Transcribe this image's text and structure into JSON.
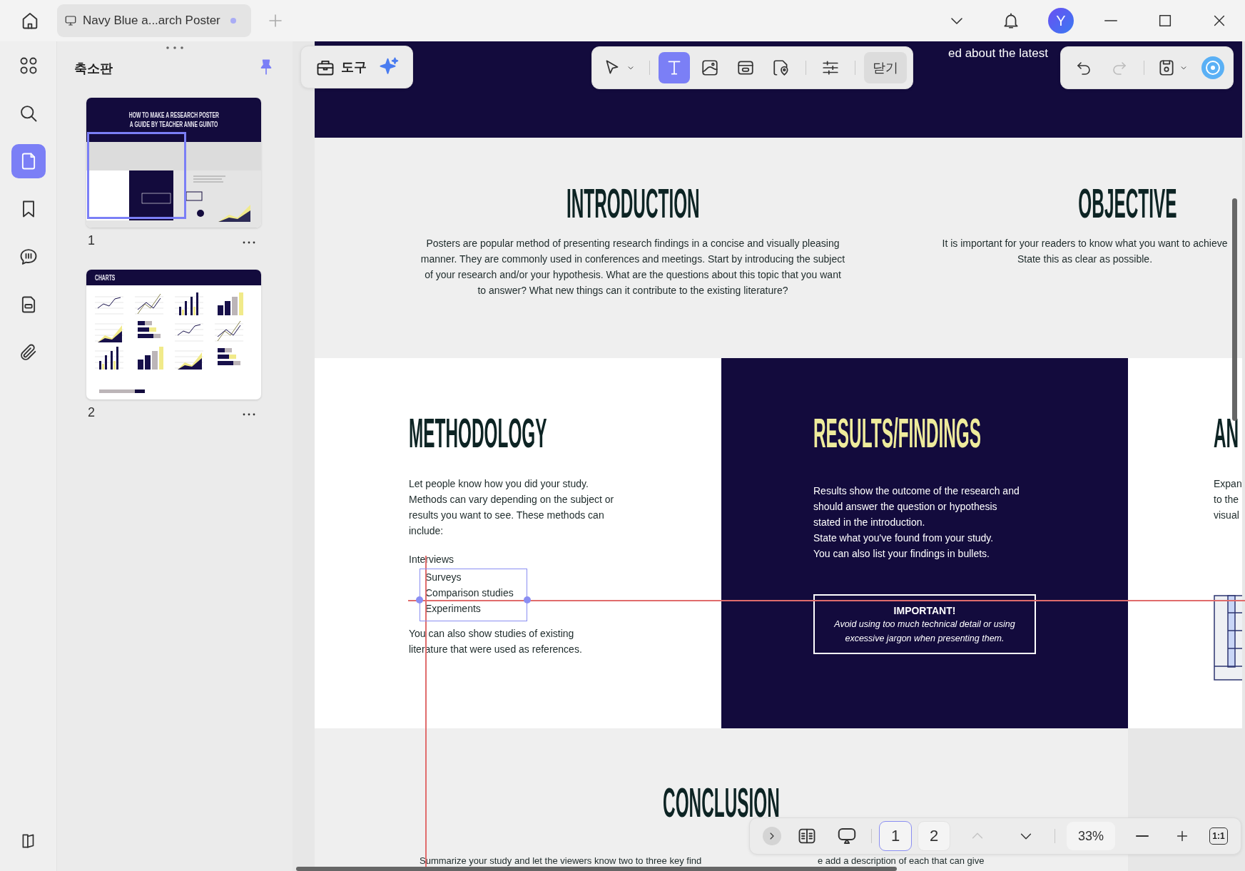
{
  "titlebar": {
    "tab": {
      "title": "Navy Blue a...arch Poster",
      "modified": true
    },
    "avatar": "Y"
  },
  "rail": [
    {
      "kind": "apps",
      "selected": false
    },
    {
      "kind": "search",
      "selected": false
    },
    {
      "kind": "pages",
      "selected": true
    },
    {
      "kind": "bookmark",
      "selected": false
    },
    {
      "kind": "comment",
      "selected": false
    },
    {
      "kind": "form",
      "selected": false
    },
    {
      "kind": "attachment",
      "selected": false
    }
  ],
  "panel": {
    "title": "축소판",
    "pinned": true
  },
  "thumbnails": [
    {
      "number": "1",
      "kind": "poster",
      "title_lines": [
        "HOW TO MAKE A RESEARCH POSTER",
        "A GUIDE BY TEACHER ANNE GUINTO"
      ]
    },
    {
      "number": "2",
      "kind": "charts",
      "title_lines": [
        "CHARTS"
      ]
    }
  ],
  "tools_bar": {
    "label": "도구"
  },
  "edit_toolbar": {
    "tools": [
      {
        "kind": "select",
        "selected": false
      },
      {
        "kind": "text",
        "selected": true
      },
      {
        "kind": "image",
        "selected": false
      },
      {
        "kind": "link",
        "selected": false
      },
      {
        "kind": "stamp",
        "selected": false
      },
      {
        "kind": "properties",
        "selected": false
      }
    ],
    "close_label": "닫기"
  },
  "history": [
    {
      "kind": "undo",
      "disabled": false
    },
    {
      "kind": "redo",
      "disabled": true
    }
  ],
  "page": {
    "banner_text": "ed about the latest",
    "introduction": {
      "heading": "INTRODUCTION",
      "lines": [
        "Posters are popular method of presenting research findings in a concise and visually pleasing",
        "manner. They are commonly used in conferences and meetings. Start by introducing the subject",
        "of your research and/or your hypothesis. What are the questions about this topic that you want",
        "to answer? What new things can it contribute to the existing literature?"
      ]
    },
    "objective": {
      "heading": "OBJECTIVE",
      "lines": [
        "It is important for your readers to know what you want to achieve",
        "State this as clear as possible."
      ]
    },
    "methodology": {
      "heading": "METHODOLOGY",
      "lines": [
        "Let people know how you did your study.",
        "Methods can vary depending on the subject or",
        "results you want to see. These methods can",
        "include:"
      ],
      "list_lead": "Interviews",
      "list": [
        "Surveys",
        "Comparison studies",
        "Experiments"
      ],
      "outro_lines": [
        "You can also show studies of existing",
        "literature that were used as references."
      ]
    },
    "results": {
      "heading": "RESULTS/FINDINGS",
      "lines": [
        "Results show the outcome of the research and",
        "should answer the question or hypothesis",
        "stated in the introduction.",
        "State what you've found from your study.",
        "You can also list your findings in bullets."
      ],
      "callout": {
        "title": "IMPORTANT!",
        "lines": [
          "Avoid using too much technical detail or using",
          "excessive jargon when presenting them."
        ]
      }
    },
    "analysis": {
      "heading": "AN",
      "lines": [
        "Expan",
        "to the",
        "visual"
      ]
    },
    "conclusion": {
      "heading": "CONCLUSION",
      "text_parts": [
        "Summarize your study and let the viewers know two to three key find",
        "e add a description of each that can give"
      ]
    }
  },
  "page_nav": {
    "pages": [
      {
        "label": "1",
        "selected": true
      },
      {
        "label": "2",
        "selected": false
      }
    ],
    "steps": [
      {
        "kind": "up",
        "disabled": true
      },
      {
        "kind": "down",
        "disabled": false
      }
    ],
    "zoom": "33%",
    "actual_size_label": "1:1"
  }
}
